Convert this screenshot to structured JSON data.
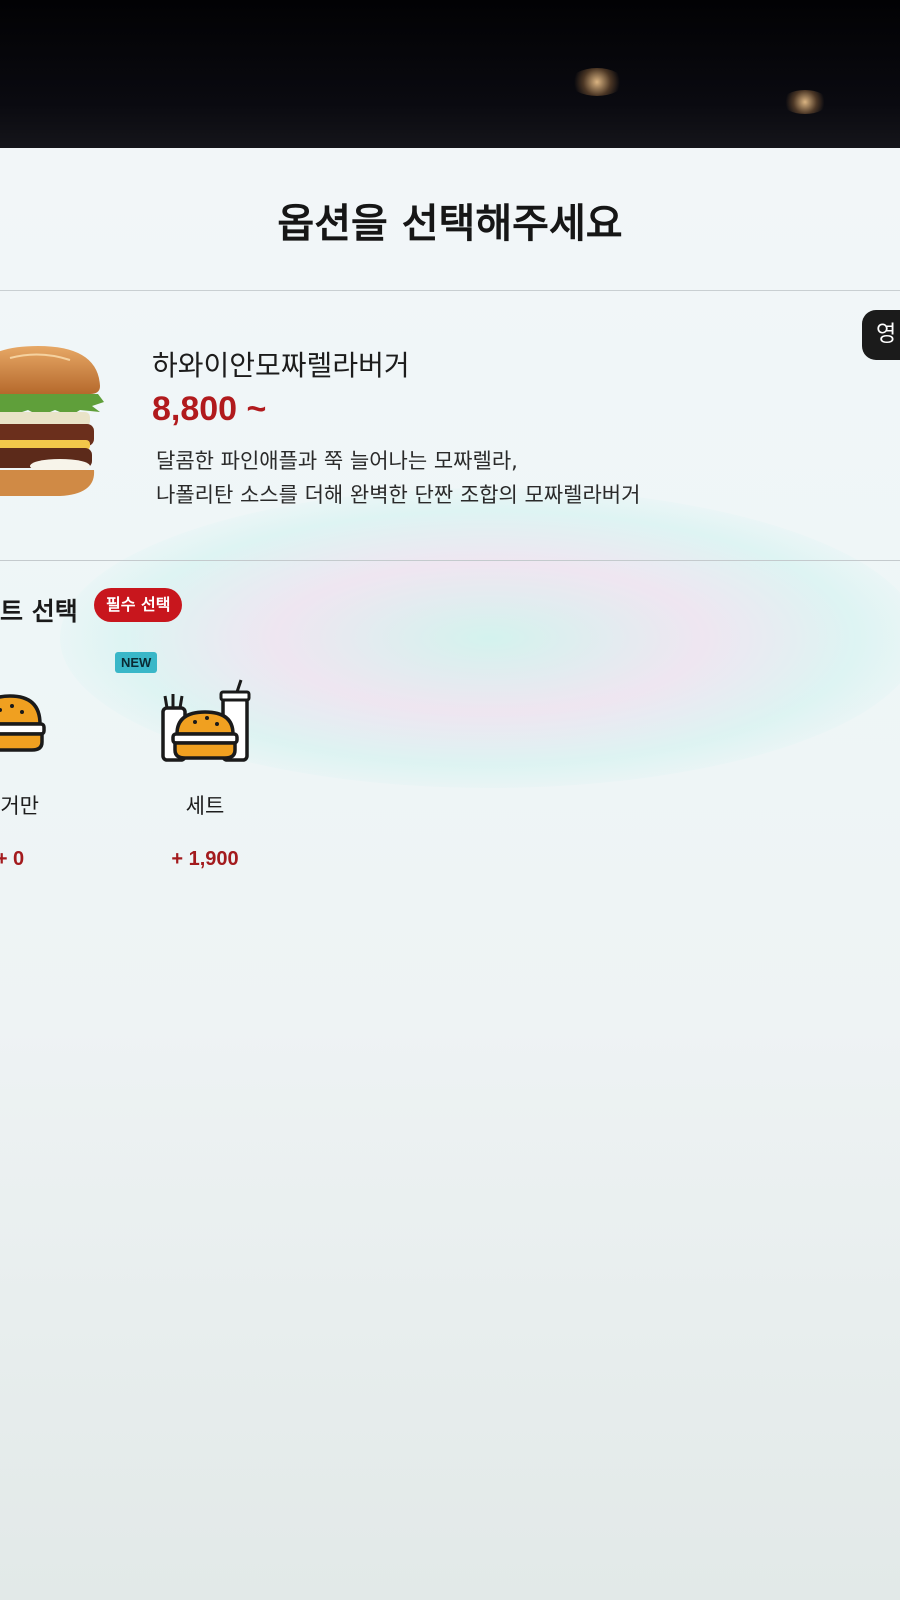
{
  "header": {
    "title": "옵션을 선택해주세요"
  },
  "language": {
    "label": "영"
  },
  "product": {
    "name": "하와이안모짜렐라버거",
    "price": "8,800 ~",
    "description_line1": "달콤한 파인애플과 쭉 늘어나는 모짜렐라,",
    "description_line2": "나폴리탄 소스를 더해 완벽한 단짠 조합의 모짜렐라버거"
  },
  "section": {
    "title": "트 선택",
    "required_badge": "필수 선택"
  },
  "options": [
    {
      "label": "버거만",
      "price": "+ 0",
      "icon": "burger-icon"
    },
    {
      "label": "세트",
      "price": "+ 1,900",
      "icon": "burger-set-icon",
      "badge": "NEW"
    }
  ],
  "colors": {
    "accent_red": "#c8161d",
    "price_red": "#b11a1d",
    "new_badge": "#39b7c8",
    "icon_orange": "#f0a020"
  }
}
